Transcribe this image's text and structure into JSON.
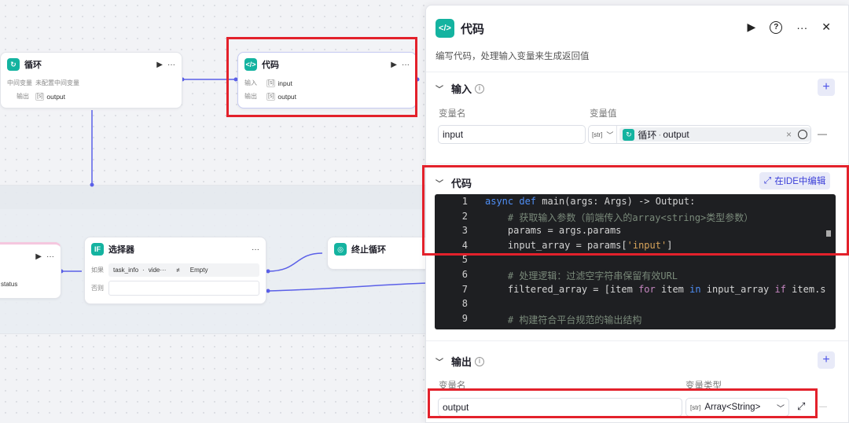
{
  "canvas": {
    "loop_node": {
      "title": "循环",
      "row1_key": "中间变量",
      "row1_val": "未配置中间变量",
      "row2_key": "输出",
      "row2_val": "output",
      "run": "▶",
      "more": "···"
    },
    "code_node": {
      "title": "代码",
      "row1_key": "输入",
      "row1_val": "input",
      "row2_key": "输出",
      "row2_val": "output",
      "run": "▶",
      "more": "···"
    },
    "left_node": {
      "status": "status",
      "run": "▶",
      "more": "···"
    },
    "selector_node": {
      "title": "选择器",
      "if_label": "如果",
      "var": "task_info",
      "dot": "·",
      "var2": "vide···",
      "op": "≠",
      "value": "Empty",
      "else_label": "否则",
      "more": "···"
    },
    "end_loop_node": {
      "title": "终止循环"
    }
  },
  "panel": {
    "title": "代码",
    "description": "编写代码，处理输入变量来生成返回值",
    "actions": {
      "run": "▶",
      "help": "?",
      "more": "···",
      "close": "✕"
    },
    "input_section": {
      "title": "输入",
      "col_name": "变量名",
      "col_value": "变量值",
      "name_value": "input",
      "value_ref_node": "循环",
      "value_ref_sep": "·",
      "value_ref_var": "output",
      "type_tag": "[str]",
      "clear": "×",
      "remove": "—"
    },
    "code_section": {
      "title": "代码",
      "ide_button": "在IDE中编辑",
      "lines": [
        {
          "n": "1",
          "html_parts": [
            [
              "kw",
              "async "
            ],
            [
              "kw",
              "def "
            ],
            [
              "",
              "main(args: Args) -> Output:"
            ]
          ]
        },
        {
          "n": "2",
          "html_parts": [
            [
              "cm",
              "    # 获取输入参数（前端传入的array<string>类型参数）"
            ]
          ]
        },
        {
          "n": "3",
          "html_parts": [
            [
              "",
              "    params = args.params"
            ]
          ]
        },
        {
          "n": "4",
          "html_parts": [
            [
              "",
              "    input_array = params["
            ],
            [
              "st",
              "'input'"
            ],
            [
              "",
              "]"
            ]
          ]
        },
        {
          "n": "5",
          "html_parts": [
            [
              "",
              ""
            ]
          ]
        },
        {
          "n": "6",
          "html_parts": [
            [
              "cm",
              "    # 处理逻辑：过滤空字符串保留有效URL"
            ]
          ]
        },
        {
          "n": "7",
          "html_parts": [
            [
              "",
              "    filtered_array = [item "
            ],
            [
              "pu",
              "for"
            ],
            [
              "",
              " item "
            ],
            [
              "kw",
              "in"
            ],
            [
              "",
              " input_array "
            ],
            [
              "pu",
              "if"
            ],
            [
              "",
              " item.s"
            ]
          ]
        },
        {
          "n": "8",
          "html_parts": [
            [
              "",
              ""
            ]
          ]
        },
        {
          "n": "9",
          "html_parts": [
            [
              "cm",
              "    # 构建符合平台规范的输出结构"
            ]
          ]
        }
      ]
    },
    "output_section": {
      "title": "输出",
      "col_name": "变量名",
      "col_type": "变量类型",
      "name_value": "output",
      "type_tag": "[str]",
      "type_value": "Array<String>"
    }
  },
  "colors": {
    "accent": "#4d53e8",
    "teal": "#14b3a0",
    "red_box": "#e3212b",
    "code_bg": "#1e1f22"
  }
}
